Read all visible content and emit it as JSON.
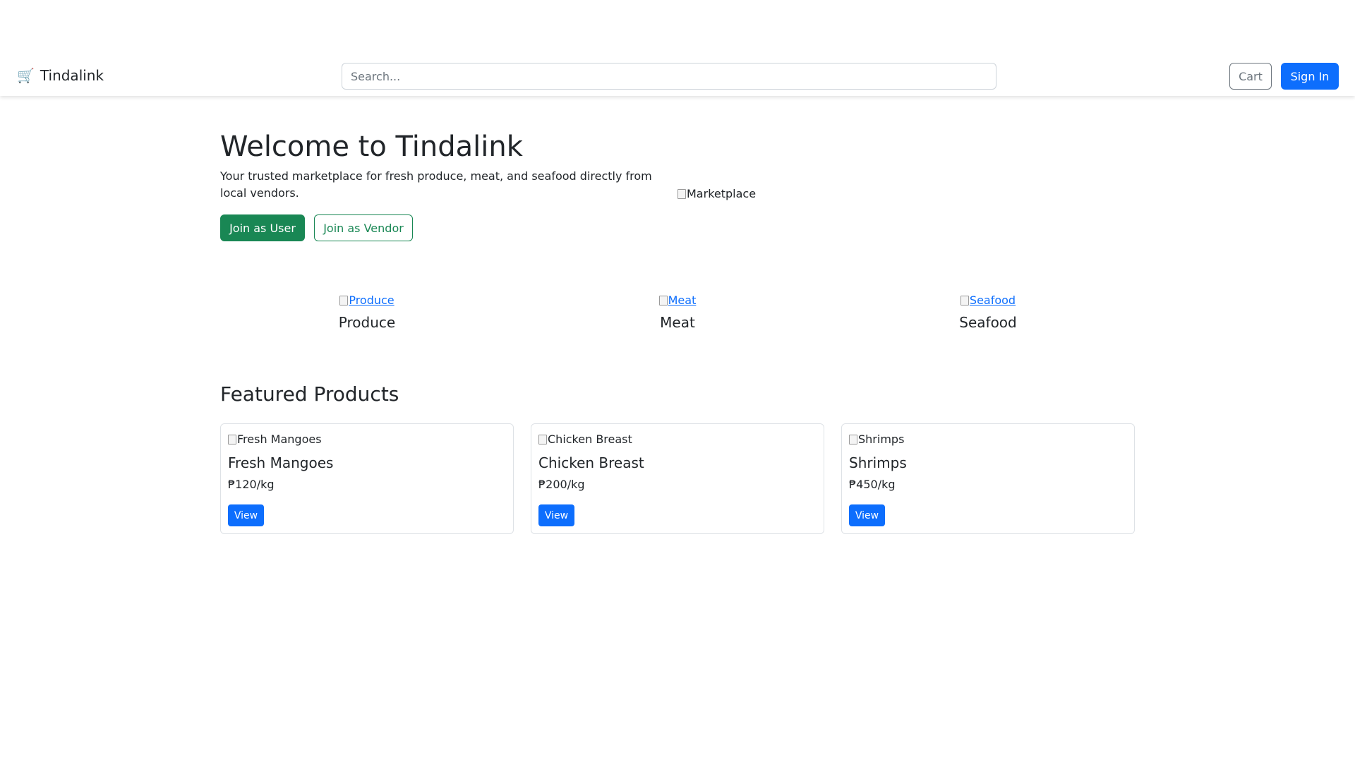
{
  "navbar": {
    "brand_icon": "🛒",
    "brand": "Tindalink",
    "search_placeholder": "Search...",
    "cart_label": "Cart",
    "signin_label": "Sign In"
  },
  "hero": {
    "title": "Welcome to Tindalink",
    "text": "Your trusted marketplace for fresh produce, meat, and seafood directly from local vendors.",
    "join_user_label": "Join as User",
    "join_vendor_label": "Join as Vendor",
    "image_alt": "Marketplace"
  },
  "categories": [
    {
      "image_alt": "Produce",
      "label": "Produce"
    },
    {
      "image_alt": "Meat",
      "label": "Meat"
    },
    {
      "image_alt": "Seafood",
      "label": "Seafood"
    }
  ],
  "featured": {
    "title": "Featured Products",
    "products": [
      {
        "image_alt": "Fresh Mangoes",
        "name": "Fresh Mangoes",
        "price": "₱120/kg",
        "button_label": "View"
      },
      {
        "image_alt": "Chicken Breast",
        "name": "Chicken Breast",
        "price": "₱200/kg",
        "button_label": "View"
      },
      {
        "image_alt": "Shrimps",
        "name": "Shrimps",
        "price": "₱450/kg",
        "button_label": "View"
      }
    ]
  },
  "colors": {
    "primary": "#0d6efd",
    "success": "#198754",
    "secondary": "#6c757d"
  }
}
